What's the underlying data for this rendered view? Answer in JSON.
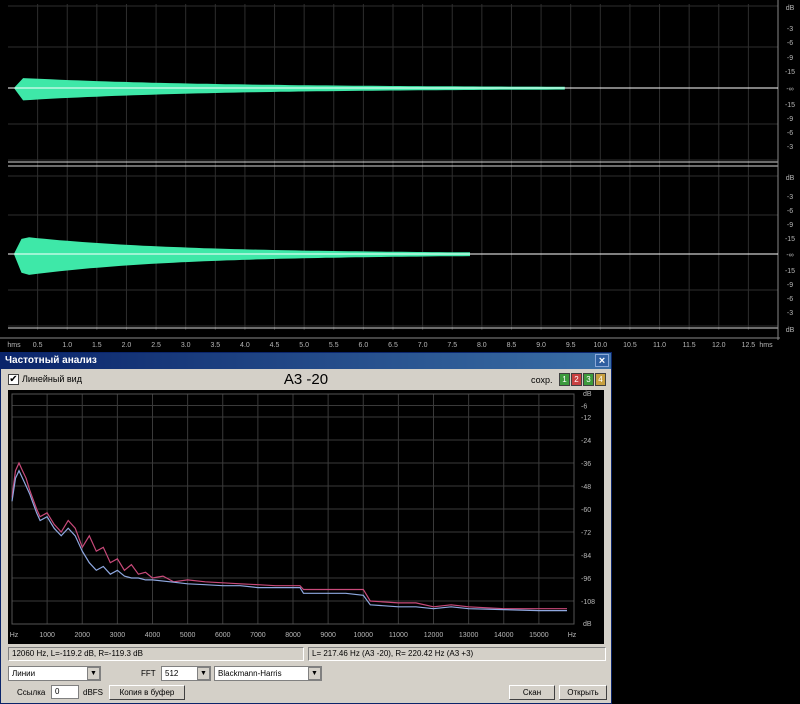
{
  "wave": {
    "db_unit": "dB",
    "db_labels": [
      "-3",
      "-6",
      "-9",
      "-15",
      "-∞",
      "-15",
      "-9",
      "-6",
      "-3"
    ],
    "time_unit": "hms",
    "time_labels": [
      "0.5",
      "1.0",
      "1.5",
      "2.0",
      "2.5",
      "3.0",
      "3.5",
      "4.0",
      "4.5",
      "5.0",
      "5.5",
      "6.0",
      "6.5",
      "7.0",
      "7.5",
      "8.0",
      "8.5",
      "9.0",
      "9.5",
      "10.0",
      "10.5",
      "11.0",
      "11.5",
      "12.0",
      "12.5"
    ],
    "time_max": 13.0,
    "waveform_color": "#3ee8a8",
    "channels": [
      {
        "name": "left",
        "end_time": 9.4
      },
      {
        "name": "right",
        "end_time": 7.8
      }
    ]
  },
  "freq_window": {
    "title": "Частотный анализ",
    "close_glyph": "×",
    "linear_view_label": "Линейный вид",
    "linear_view_checked": true,
    "check_glyph": "✔",
    "preset_title": "A3 -20",
    "save_label": "сохр.",
    "slots": [
      {
        "label": "1",
        "color": "#3c9a3c"
      },
      {
        "label": "2",
        "color": "#c84040"
      },
      {
        "label": "3",
        "color": "#3c9a3c"
      },
      {
        "label": "4",
        "color": "#c8a040"
      }
    ],
    "status_left": "12060 Hz, L=-119.2 dB, R=-119.3 dB",
    "status_right": "L= 217.46 Hz (A3 -20), R= 220.42 Hz (A3 +3)",
    "display_mode": "Линии",
    "fft_label": "FFT",
    "fft_size": "512",
    "window_function": "Blackmann-Harris",
    "dropdown_glyph": "▼",
    "reference_label": "Ссылка",
    "reference_value": "0",
    "reference_unit": "dBFS",
    "copy_button": "Копия в буфер",
    "scan_button": "Скан",
    "open_button": "Открыть"
  },
  "chart_data": {
    "type": "line",
    "xlabel": "Hz",
    "ylabel": "dB",
    "xlim": [
      0,
      16000
    ],
    "ylim": [
      -120,
      0
    ],
    "x_ticks": [
      1000,
      2000,
      3000,
      4000,
      5000,
      6000,
      7000,
      8000,
      9000,
      10000,
      11000,
      12000,
      13000,
      14000,
      15000
    ],
    "y_ticks": [
      -6,
      -12,
      -24,
      -36,
      -48,
      -60,
      -72,
      -84,
      -96,
      -108
    ],
    "grid": true,
    "background": "#000000",
    "series": [
      {
        "color": "#c84a7a",
        "points": [
          [
            0,
            -54
          ],
          [
            100,
            -40
          ],
          [
            200,
            -36
          ],
          [
            300,
            -40
          ],
          [
            400,
            -44
          ],
          [
            500,
            -50
          ],
          [
            600,
            -55
          ],
          [
            700,
            -60
          ],
          [
            800,
            -64
          ],
          [
            1000,
            -62
          ],
          [
            1200,
            -68
          ],
          [
            1400,
            -72
          ],
          [
            1600,
            -66
          ],
          [
            1800,
            -70
          ],
          [
            2000,
            -80
          ],
          [
            2200,
            -74
          ],
          [
            2400,
            -82
          ],
          [
            2600,
            -80
          ],
          [
            2800,
            -88
          ],
          [
            3000,
            -86
          ],
          [
            3200,
            -92
          ],
          [
            3400,
            -89
          ],
          [
            3600,
            -94
          ],
          [
            3800,
            -93
          ],
          [
            4000,
            -96
          ],
          [
            4300,
            -95
          ],
          [
            4600,
            -98
          ],
          [
            5000,
            -97
          ],
          [
            5500,
            -98
          ],
          [
            6000,
            -98.5
          ],
          [
            6500,
            -99
          ],
          [
            7000,
            -99.5
          ],
          [
            7500,
            -100
          ],
          [
            8000,
            -100
          ],
          [
            8200,
            -100
          ],
          [
            8300,
            -102
          ],
          [
            9000,
            -102
          ],
          [
            9500,
            -102
          ],
          [
            9800,
            -102
          ],
          [
            10000,
            -102
          ],
          [
            10200,
            -108
          ],
          [
            11000,
            -109
          ],
          [
            11500,
            -109
          ],
          [
            12000,
            -111
          ],
          [
            12500,
            -110
          ],
          [
            13000,
            -111
          ],
          [
            14000,
            -112
          ],
          [
            15000,
            -112
          ],
          [
            15800,
            -112
          ]
        ]
      },
      {
        "color": "#8fa8e0",
        "points": [
          [
            0,
            -56
          ],
          [
            100,
            -44
          ],
          [
            200,
            -40
          ],
          [
            300,
            -44
          ],
          [
            400,
            -48
          ],
          [
            500,
            -52
          ],
          [
            600,
            -57
          ],
          [
            700,
            -62
          ],
          [
            800,
            -66
          ],
          [
            1000,
            -64
          ],
          [
            1200,
            -70
          ],
          [
            1400,
            -74
          ],
          [
            1600,
            -70
          ],
          [
            1800,
            -74
          ],
          [
            2000,
            -82
          ],
          [
            2200,
            -88
          ],
          [
            2400,
            -92
          ],
          [
            2600,
            -90
          ],
          [
            2800,
            -94
          ],
          [
            3000,
            -92
          ],
          [
            3200,
            -95
          ],
          [
            3400,
            -96
          ],
          [
            3600,
            -96
          ],
          [
            3800,
            -97
          ],
          [
            4000,
            -97
          ],
          [
            4500,
            -98
          ],
          [
            5000,
            -99
          ],
          [
            5500,
            -99.5
          ],
          [
            6000,
            -100
          ],
          [
            6500,
            -100
          ],
          [
            7000,
            -101
          ],
          [
            7500,
            -101
          ],
          [
            8000,
            -101
          ],
          [
            8200,
            -101
          ],
          [
            8300,
            -104
          ],
          [
            9000,
            -104
          ],
          [
            9500,
            -104
          ],
          [
            10000,
            -105
          ],
          [
            10200,
            -110
          ],
          [
            11000,
            -111
          ],
          [
            11500,
            -111
          ],
          [
            12000,
            -112
          ],
          [
            12500,
            -111
          ],
          [
            13000,
            -112
          ],
          [
            14000,
            -112.5
          ],
          [
            15000,
            -113
          ],
          [
            15800,
            -113
          ]
        ]
      }
    ]
  }
}
